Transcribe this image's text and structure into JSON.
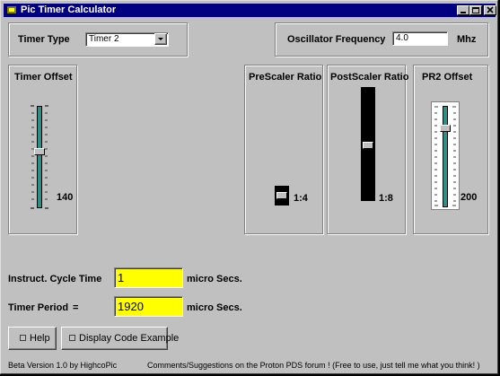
{
  "window": {
    "title": "Pic Timer Calculator",
    "minimize": "_",
    "maximize": "□",
    "close": "×"
  },
  "timer_type": {
    "label": "Timer Type",
    "selected": "Timer 2"
  },
  "oscillator": {
    "label": "Oscillator Frequency",
    "value": "4.0",
    "unit": "Mhz"
  },
  "timer_offset": {
    "title": "Timer Offset",
    "value_label": "140",
    "level": 0.55
  },
  "prescaler": {
    "title": "PreScaler Ratio",
    "value_label": "1:4"
  },
  "postscaler": {
    "title": "PostScaler Ratio",
    "value_label": "1:8",
    "level": 0.55
  },
  "pr2_offset": {
    "title": "PR2 Offset",
    "value_label": "200",
    "level": 0.78
  },
  "cycle_time": {
    "label": "Instruct. Cycle Time",
    "value": "1",
    "unit": "micro Secs."
  },
  "timer_period": {
    "label": "Timer Period",
    "equals": "=",
    "value": "1920",
    "unit": "micro Secs."
  },
  "buttons": {
    "help": "Help",
    "display_code": "Display Code Example"
  },
  "footer": {
    "version": "Beta Version 1.0 by HighcoPic",
    "comments": "Comments/Suggestions on the Proton PDS forum ! (Free to use, just tell me what you think! )"
  }
}
